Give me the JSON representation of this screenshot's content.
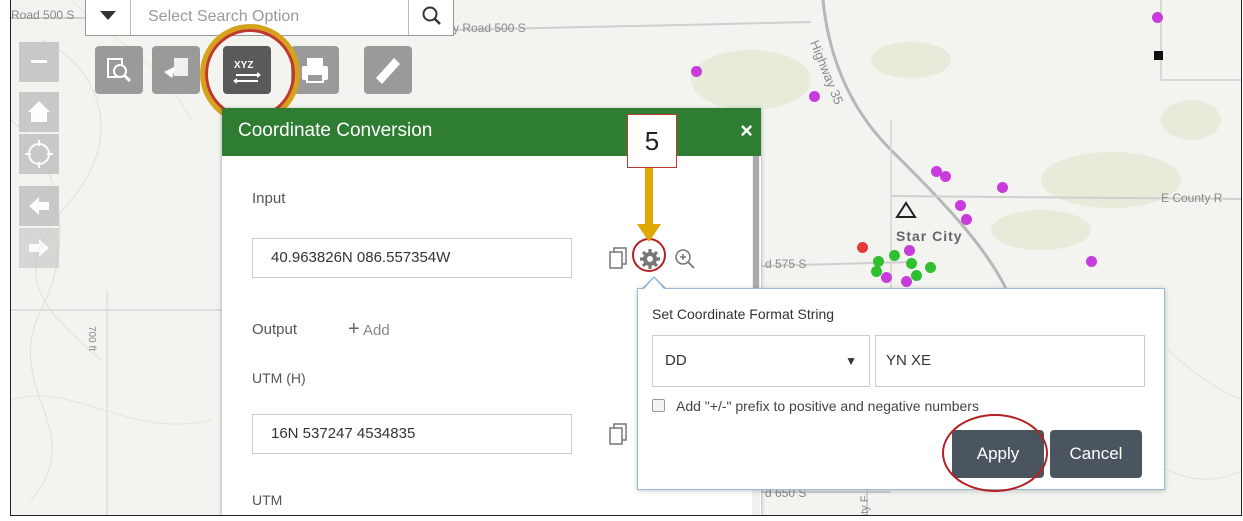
{
  "search": {
    "placeholder": "Select Search Option"
  },
  "map_labels": {
    "road_left": "Road 500 S",
    "road_mid": "y Road 500 S",
    "highway": "Highway 35",
    "county_road": "E County R",
    "star_city": "Star City",
    "road_575": "d 575 S",
    "road_650": "d 650 S",
    "elev": "700 ft",
    "county_vertical": "nty F"
  },
  "toolbar": {
    "tools": [
      "zoom-search",
      "select",
      "coordinate-xyz",
      "print",
      "measure"
    ],
    "xyz_label": "XYZ"
  },
  "panel": {
    "title": "Coordinate Conversion",
    "close": "×",
    "input_label": "Input",
    "input_value": "40.963826N 086.557354W",
    "output_label": "Output",
    "add_label": "Add",
    "utm_h_label": "UTM (H)",
    "utm_h_value": "16N 537247 4534835",
    "utm_label": "UTM"
  },
  "callout": {
    "number": "5"
  },
  "format_popup": {
    "title": "Set Coordinate Format String",
    "format_type": "DD",
    "format_string": "YN XE",
    "checkbox_label": "Add \"+/-\" prefix to positive and negative numbers",
    "checkbox_checked": false,
    "apply": "Apply",
    "cancel": "Cancel"
  },
  "colors": {
    "panel_header": "#2e7d32",
    "highlight_gold": "#d7a21b",
    "highlight_red": "#b22222",
    "arrow": "#e0a800",
    "button": "#4a5560",
    "dot_purple": "#c83cdc",
    "dot_green": "#2fbf2f"
  }
}
